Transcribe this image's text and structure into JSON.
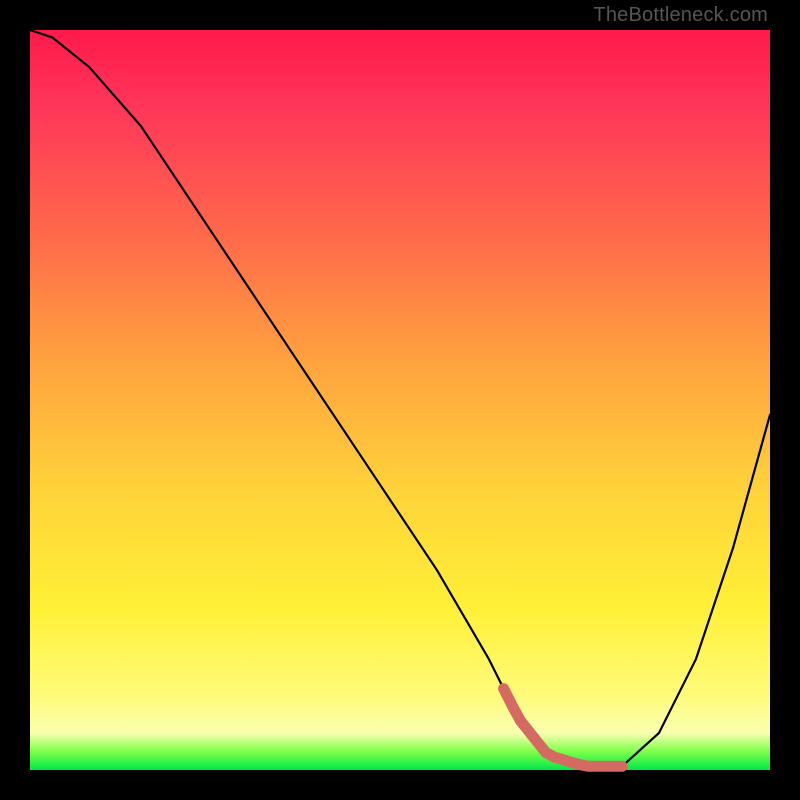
{
  "watermark": "TheBottleneck.com",
  "chart_data": {
    "type": "line",
    "title": "",
    "xlabel": "",
    "ylabel": "",
    "xlim": [
      0,
      100
    ],
    "ylim": [
      0,
      100
    ],
    "series": [
      {
        "name": "bottleneck-curve",
        "x": [
          0,
          3,
          8,
          15,
          25,
          35,
          45,
          55,
          62,
          66,
          70,
          75,
          78,
          80,
          85,
          90,
          95,
          100
        ],
        "values": [
          100,
          99,
          95,
          87,
          72,
          57,
          42,
          27,
          15,
          7,
          2,
          0.5,
          0.5,
          0.5,
          5,
          15,
          30,
          48
        ]
      }
    ],
    "highlight": {
      "name": "optimal-range",
      "x_start": 64,
      "x_end": 80,
      "color": "#d56a63"
    },
    "gradient_stops": [
      {
        "pos": 0,
        "color": "#ff1a4b"
      },
      {
        "pos": 28,
        "color": "#ff6a4a"
      },
      {
        "pos": 62,
        "color": "#ffd23a"
      },
      {
        "pos": 90,
        "color": "#fffb7a"
      },
      {
        "pos": 98,
        "color": "#00e84a"
      }
    ]
  }
}
